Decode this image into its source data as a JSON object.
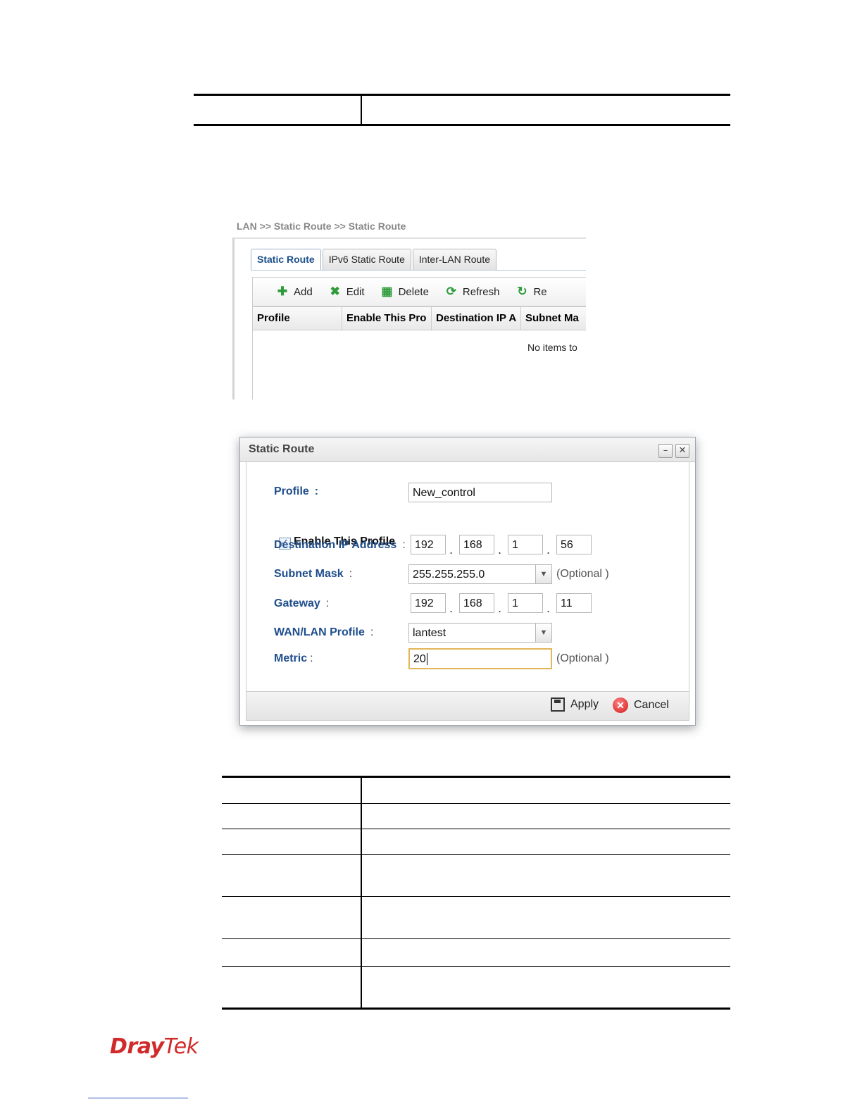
{
  "screenshot_ui": {
    "breadcrumb": "LAN >> Static Route >> Static Route",
    "tabs": [
      "Static Route",
      "IPv6 Static Route",
      "Inter-LAN Route"
    ],
    "toolbar": [
      "Add",
      "Edit",
      "Delete",
      "Refresh",
      "Re"
    ],
    "columns": [
      "Profile",
      "Enable This Pro",
      "Destination IP A",
      "Subnet Ma"
    ],
    "empty_text": "No items to"
  },
  "dialog": {
    "title": "Static Route",
    "profile_label": "Profile",
    "profile_value": "New_control",
    "enable_label": "Enable This Profile",
    "enable_checked": true,
    "dest_label": "Destination IP Address",
    "dest_ip": [
      "192",
      "168",
      "1",
      "56"
    ],
    "subnet_label": "Subnet Mask",
    "subnet_value": "255.255.255.0",
    "subnet_opt": "(Optional )",
    "gateway_label": "Gateway",
    "gateway_ip": [
      "192",
      "168",
      "1",
      "11"
    ],
    "wanlan_label": "WAN/LAN Profile",
    "wanlan_value": "lantest",
    "metric_label": "Metric",
    "metric_value": "20",
    "metric_opt": "(Optional )",
    "apply_label": "Apply",
    "cancel_label": "Cancel"
  },
  "logo": {
    "part1": "Dray",
    "part2": "Tek"
  }
}
